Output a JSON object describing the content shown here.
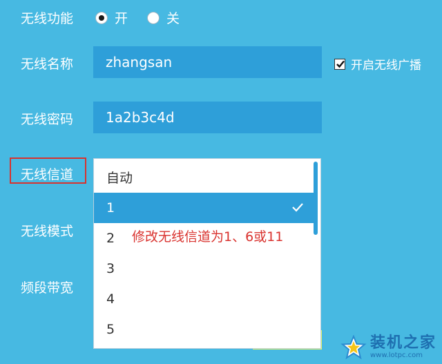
{
  "wireless_function": {
    "label": "无线功能",
    "options": [
      {
        "label": "开",
        "checked": true
      },
      {
        "label": "关",
        "checked": false
      }
    ]
  },
  "ssid": {
    "label": "无线名称",
    "value": "zhangsan"
  },
  "broadcast": {
    "label": "开启无线广播",
    "checked": true
  },
  "password": {
    "label": "无线密码",
    "value": "1a2b3c4d"
  },
  "channel": {
    "label": "无线信道",
    "options": [
      "自动",
      "1",
      "2",
      "3",
      "4",
      "5"
    ],
    "selected": "1"
  },
  "mode": {
    "label": "无线模式"
  },
  "bandwidth": {
    "label": "频段带宽"
  },
  "annotation": "修改无线信道为1、6或11",
  "watermark": {
    "title": "装机之家",
    "url": "www.lotpc.com"
  },
  "colors": {
    "background": "#47b9e2",
    "field": "#2e9fd9",
    "highlight_border": "#d9322e",
    "annotation": "#d9322e",
    "watermark": "#1e6fb0"
  }
}
